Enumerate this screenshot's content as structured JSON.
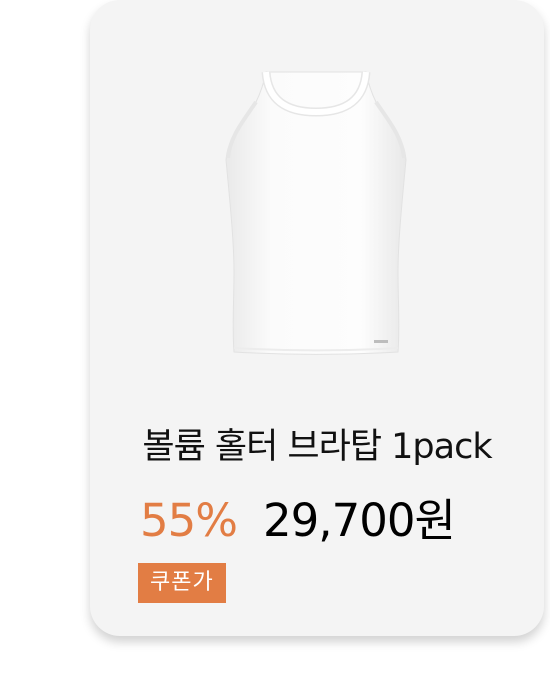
{
  "product": {
    "title": "볼륨 홀터 브라탑 1pack",
    "image_icon": "white-halter-tank-top",
    "discount": "55%",
    "price": "29,700원",
    "coupon_label": "쿠폰가"
  },
  "colors": {
    "accent": "#e27d44",
    "card_background": "#f4f4f4"
  }
}
